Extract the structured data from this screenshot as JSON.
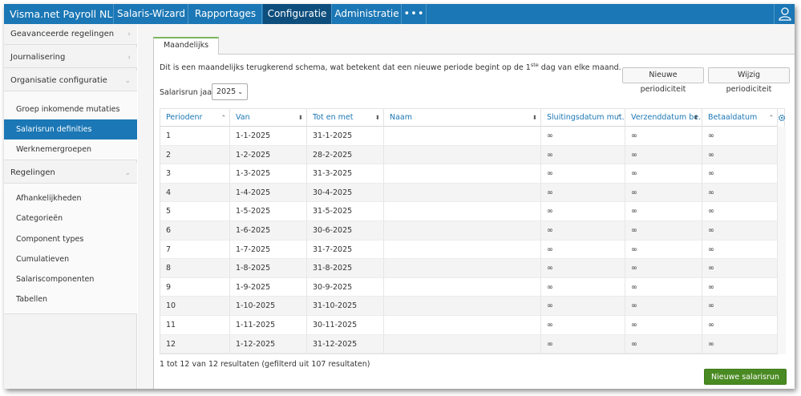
{
  "app": {
    "brand": "Visma.net Payroll NL"
  },
  "nav": {
    "items": [
      {
        "label": "Salaris-Wizard"
      },
      {
        "label": "Rapportages"
      },
      {
        "label": "Configuratie"
      },
      {
        "label": "Administratie"
      }
    ],
    "more": "•••"
  },
  "sidebar": {
    "sections": [
      {
        "label": "Geavanceerde regelingen"
      },
      {
        "label": "Journalisering"
      },
      {
        "label": "Organisatie configuratie"
      },
      {
        "label": "Regelingen"
      }
    ],
    "org_items": [
      {
        "label": "Groep inkomende mutaties"
      },
      {
        "label": "Salarisrun definities"
      },
      {
        "label": "Werknemergroepen"
      }
    ],
    "reg_items": [
      {
        "label": "Afhankelijkheden"
      },
      {
        "label": "Categorieën"
      },
      {
        "label": "Component types"
      },
      {
        "label": "Cumulatieven"
      },
      {
        "label": "Salariscomponenten"
      },
      {
        "label": "Tabellen"
      }
    ]
  },
  "main": {
    "tab_label": "Maandelijks",
    "desc_before": "Dit is een maandelijks terugkerend schema, wat betekent dat een nieuwe periode begint op de 1",
    "desc_sup": "ste",
    "desc_after": " dag van elke maand.",
    "btn_new_periodicity": "Nieuwe periodiciteit",
    "btn_edit_periodicity": "Wijzig periodiciteit",
    "year_label": "Salarisrun jaar:",
    "year_value": "2025",
    "result_text": "1 tot 12 van 12 resultaten (gefilterd uit 107 resultaten)",
    "btn_new_run": "Nieuwe salarisrun"
  },
  "table": {
    "columns": [
      {
        "label": "Periodenr"
      },
      {
        "label": "Van"
      },
      {
        "label": "Tot en met"
      },
      {
        "label": "Naam"
      },
      {
        "label": "Sluitingsdatum mut..."
      },
      {
        "label": "Verzenddatum be..."
      },
      {
        "label": "Betaaldatum"
      }
    ],
    "rows": [
      {
        "nr": "1",
        "van": "1-1-2025",
        "tot": "31-1-2025",
        "naam": "",
        "sluit": "∞",
        "verz": "∞",
        "betaal": "∞"
      },
      {
        "nr": "2",
        "van": "1-2-2025",
        "tot": "28-2-2025",
        "naam": "",
        "sluit": "∞",
        "verz": "∞",
        "betaal": "∞"
      },
      {
        "nr": "3",
        "van": "1-3-2025",
        "tot": "31-3-2025",
        "naam": "",
        "sluit": "∞",
        "verz": "∞",
        "betaal": "∞"
      },
      {
        "nr": "4",
        "van": "1-4-2025",
        "tot": "30-4-2025",
        "naam": "",
        "sluit": "∞",
        "verz": "∞",
        "betaal": "∞"
      },
      {
        "nr": "5",
        "van": "1-5-2025",
        "tot": "31-5-2025",
        "naam": "",
        "sluit": "∞",
        "verz": "∞",
        "betaal": "∞"
      },
      {
        "nr": "6",
        "van": "1-6-2025",
        "tot": "30-6-2025",
        "naam": "",
        "sluit": "∞",
        "verz": "∞",
        "betaal": "∞"
      },
      {
        "nr": "7",
        "van": "1-7-2025",
        "tot": "31-7-2025",
        "naam": "",
        "sluit": "∞",
        "verz": "∞",
        "betaal": "∞"
      },
      {
        "nr": "8",
        "van": "1-8-2025",
        "tot": "31-8-2025",
        "naam": "",
        "sluit": "∞",
        "verz": "∞",
        "betaal": "∞"
      },
      {
        "nr": "9",
        "van": "1-9-2025",
        "tot": "30-9-2025",
        "naam": "",
        "sluit": "∞",
        "verz": "∞",
        "betaal": "∞"
      },
      {
        "nr": "10",
        "van": "1-10-2025",
        "tot": "31-10-2025",
        "naam": "",
        "sluit": "∞",
        "verz": "∞",
        "betaal": "∞"
      },
      {
        "nr": "11",
        "van": "1-11-2025",
        "tot": "30-11-2025",
        "naam": "",
        "sluit": "∞",
        "verz": "∞",
        "betaal": "∞"
      },
      {
        "nr": "12",
        "van": "1-12-2025",
        "tot": "31-12-2025",
        "naam": "",
        "sluit": "∞",
        "verz": "∞",
        "betaal": "∞"
      }
    ]
  },
  "colors": {
    "brand_blue": "#1b77b5",
    "nav_active": "#0e4e7d",
    "accent_green": "#4a8a22",
    "tab_green": "#7ab55c"
  },
  "icons": {
    "user": "user-icon",
    "gear": "gear-icon",
    "sort": "sort-icon",
    "chevron": "chevron-icon"
  }
}
